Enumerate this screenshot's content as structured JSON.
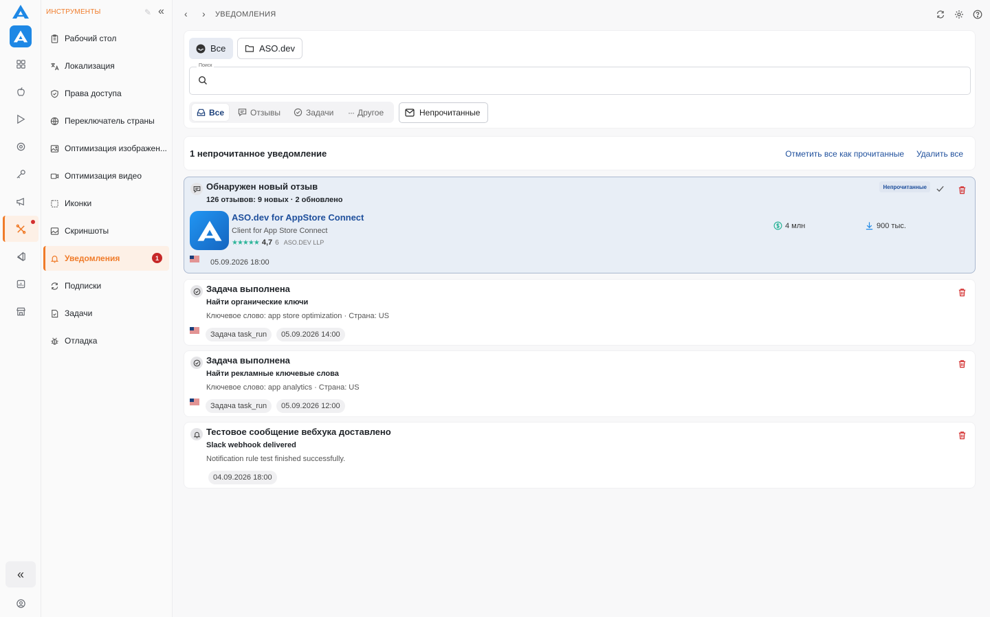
{
  "tools": {
    "title": "ИНСТРУМЕНТЫ",
    "items": [
      {
        "label": "Рабочий стол",
        "icon": "clipboard-icon"
      },
      {
        "label": "Локализация",
        "icon": "translate-icon"
      },
      {
        "label": "Права доступа",
        "icon": "shield-icon"
      },
      {
        "label": "Переключатель страны",
        "icon": "globe-icon"
      },
      {
        "label": "Оптимизация изображен...",
        "icon": "image-icon"
      },
      {
        "label": "Оптимизация видео",
        "icon": "video-icon"
      },
      {
        "label": "Иконки",
        "icon": "icons-icon"
      },
      {
        "label": "Скриншоты",
        "icon": "screenshot-icon"
      },
      {
        "label": "Уведомления",
        "icon": "bell-icon",
        "badge": "1"
      },
      {
        "label": "Подписки",
        "icon": "refresh-icon"
      },
      {
        "label": "Задачи",
        "icon": "task-icon"
      },
      {
        "label": "Отладка",
        "icon": "bug-icon"
      }
    ]
  },
  "topbar": {
    "title": "УВЕДОМЛЕНИЯ"
  },
  "filters": {
    "scope_all": "Все",
    "scope_app": "ASO.dev",
    "search_label": "Поиск",
    "search_value": "",
    "tabs": [
      "Все",
      "Отзывы",
      "Задачи",
      "Другое"
    ],
    "unread": "Непрочитанные"
  },
  "list": {
    "count_text": "1 непрочитанное уведомление",
    "mark_all": "Отметить все как прочитанные",
    "delete_all": "Удалить все"
  },
  "notifications": [
    {
      "title": "Обнаружен новый отзыв",
      "subtitle": "126 отзывов: 9 новых · 2 обновлено",
      "badge": "Непрочитанные",
      "app_name": "ASO.dev for AppStore Connect",
      "app_tagline": "Client for App Store Connect",
      "stars": "★★★★★",
      "rating": "4,7",
      "rating_count": "6",
      "developer": "ASO.DEV LLP",
      "revenue": "4 млн",
      "downloads": "900 тыс.",
      "date": "05.09.2026 18:00"
    },
    {
      "title": "Задача выполнена",
      "subtitle": "Найти органические ключи",
      "desc": "Ключевое слово: app store optimization · Страна: US",
      "task": "Задача task_run",
      "date": "05.09.2026 14:00"
    },
    {
      "title": "Задача выполнена",
      "subtitle": "Найти рекламные ключевые слова",
      "desc": "Ключевое слово: app analytics · Страна: US",
      "task": "Задача task_run",
      "date": "05.09.2026 12:00"
    },
    {
      "title": "Тестовое сообщение вебхука доставлено",
      "subtitle": "Slack webhook delivered",
      "desc": "Notification rule test finished successfully.",
      "date": "04.09.2026 18:00"
    }
  ],
  "colors": {
    "accent": "#f07b29",
    "link": "#1e4f9c",
    "danger": "#d32f2f",
    "unread_bg": "#e8eef6"
  }
}
